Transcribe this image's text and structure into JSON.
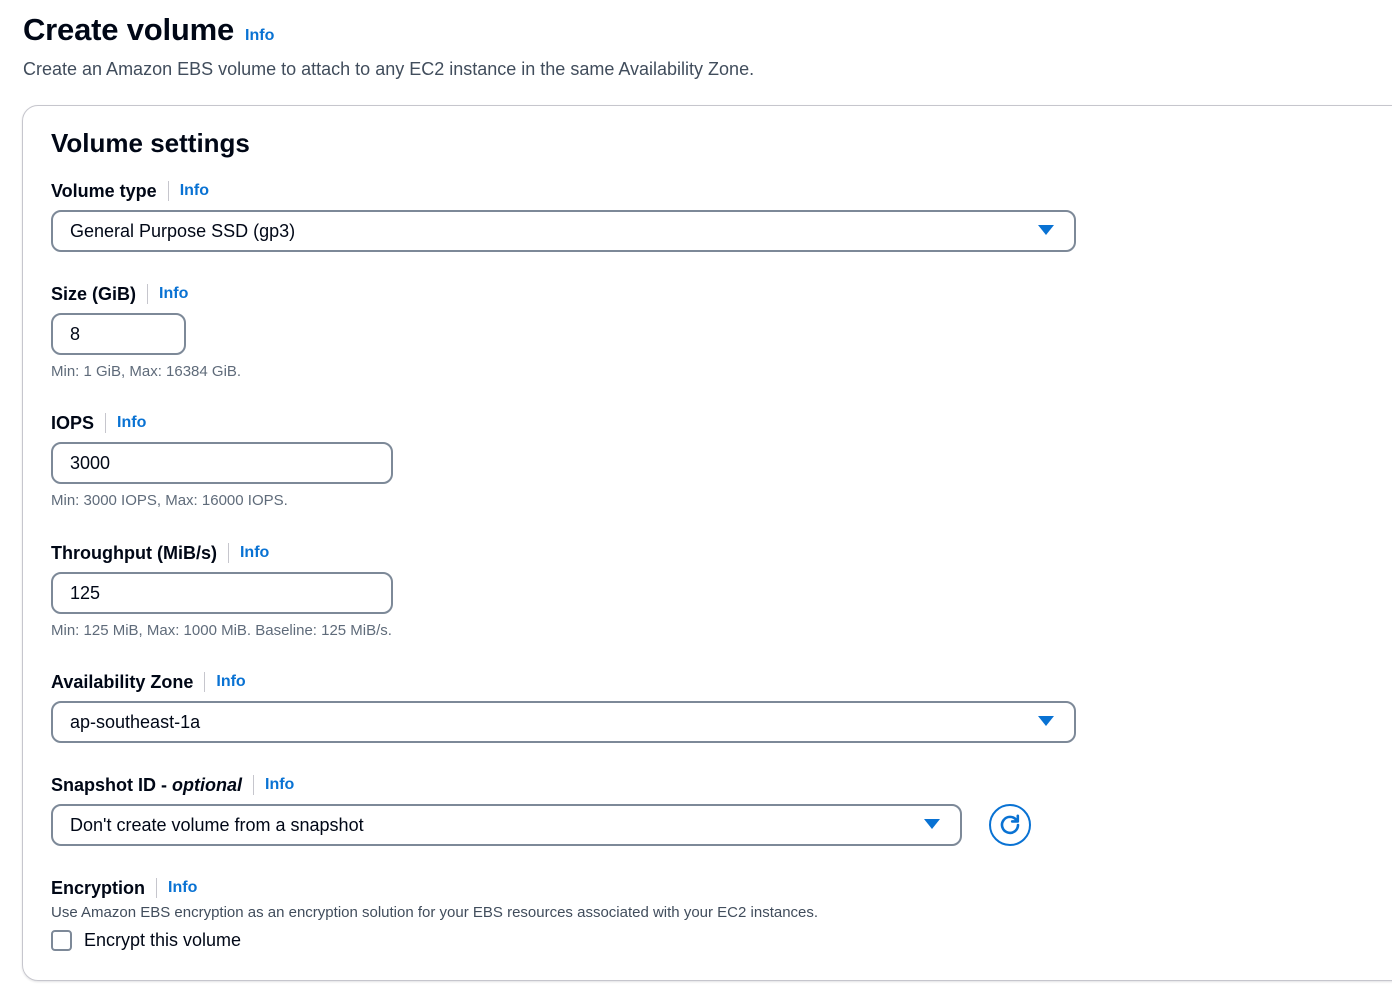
{
  "header": {
    "title": "Create volume",
    "info": "Info",
    "subtitle": "Create an Amazon EBS volume to attach to any EC2 instance in the same Availability Zone."
  },
  "volume_settings": {
    "title": "Volume settings",
    "volume_type": {
      "label": "Volume type",
      "info": "Info",
      "value": "General Purpose SSD (gp3)"
    },
    "size": {
      "label": "Size (GiB)",
      "info": "Info",
      "value": "8",
      "hint": "Min: 1 GiB, Max: 16384 GiB."
    },
    "iops": {
      "label": "IOPS",
      "info": "Info",
      "value": "3000",
      "hint": "Min: 3000 IOPS, Max: 16000 IOPS."
    },
    "throughput": {
      "label": "Throughput (MiB/s)",
      "info": "Info",
      "value": "125",
      "hint": "Min: 125 MiB, Max: 1000 MiB. Baseline: 125 MiB/s."
    },
    "availability_zone": {
      "label": "Availability Zone",
      "info": "Info",
      "value": "ap-southeast-1a"
    },
    "snapshot": {
      "label": "Snapshot ID - ",
      "label_optional": "optional",
      "info": "Info",
      "value": "Don't create volume from a snapshot",
      "refresh_icon": "refresh-icon"
    },
    "encryption": {
      "label": "Encryption",
      "info": "Info",
      "description": "Use Amazon EBS encryption as an encryption solution for your EBS resources associated with your EC2 instances.",
      "checkbox_label": "Encrypt this volume",
      "checked": false
    }
  },
  "colors": {
    "accent": "#0972d3",
    "text": "#000716",
    "border": "#7d8998",
    "hint": "#5f6b7a"
  }
}
